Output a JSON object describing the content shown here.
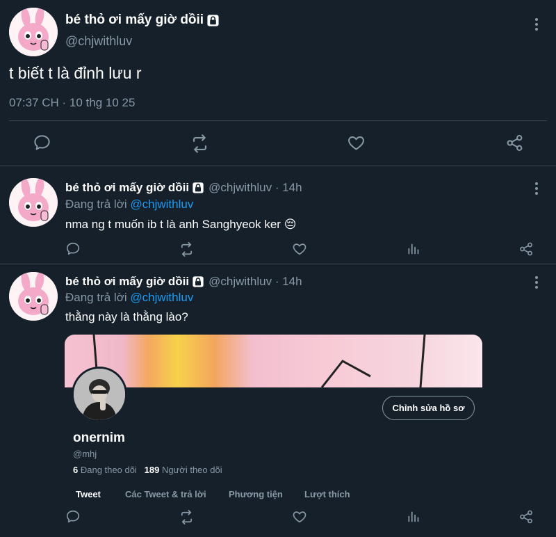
{
  "main_tweet": {
    "display_name": "bé thỏ ơi mấy giờ dồii",
    "handle": "@chjwithluv",
    "text": "t biết t là đỉnh lưu r",
    "timestamp": "07:37 CH · 10 thg 10 25"
  },
  "replies": [
    {
      "display_name": "bé thỏ ơi mấy giờ dồii",
      "handle_time": "@chjwithluv · 14h",
      "replying_prefix": "Đang trả lời",
      "replying_to": "@chjwithluv",
      "text": "nma ng t muốn ib t là anh Sanghyeok ker 😔"
    },
    {
      "display_name": "bé thỏ ơi mấy giờ dồii",
      "handle_time": "@chjwithluv · 14h",
      "replying_prefix": "Đang trả lời",
      "replying_to": "@chjwithluv",
      "text": "thằng này là thằng lào?"
    }
  ],
  "profile_card": {
    "name": "onernim",
    "handle": "@mhj",
    "following_count": "6",
    "following_label": "Đang theo dõi",
    "followers_count": "189",
    "followers_label": "Người theo dõi",
    "edit_button": "Chỉnh sửa hồ sơ",
    "tabs": [
      "Tweet",
      "Các Tweet & trả lời",
      "Phương tiện",
      "Lượt thích"
    ]
  },
  "icons": [
    "reply-icon",
    "retweet-icon",
    "like-icon",
    "analytics-icon",
    "share-icon",
    "lock-icon",
    "more-icon"
  ],
  "colors": {
    "background": "#15202b",
    "muted": "#8899a6",
    "link": "#1d9bf0",
    "divider": "#38444d"
  }
}
